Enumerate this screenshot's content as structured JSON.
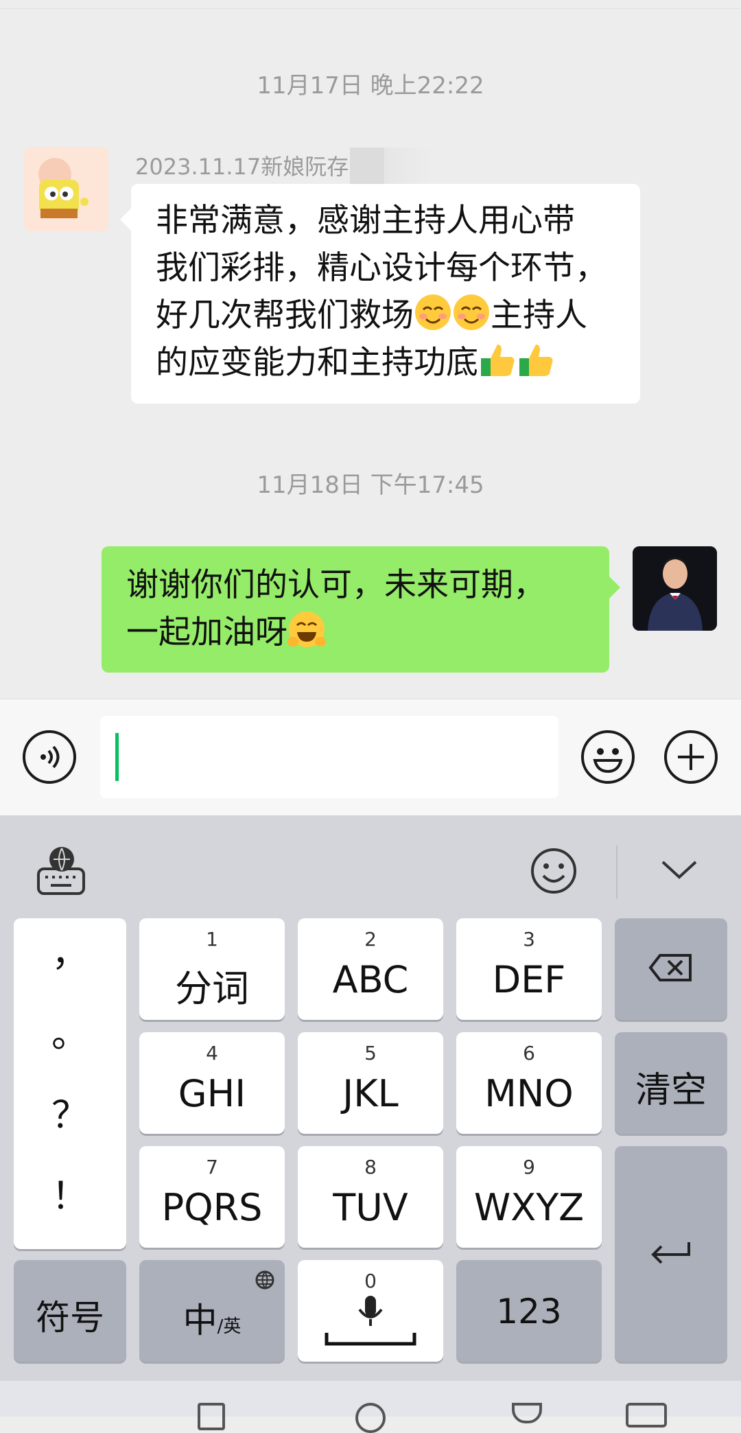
{
  "chat": {
    "timestamps": [
      "11月17日 晚上22:22",
      "11月18日 下午17:45"
    ],
    "incoming": {
      "sender": "2023.11.17新娘阮存",
      "lines": [
        "非常满意，感谢主持人用心带",
        "我们彩排，精心设计每个环节，",
        "好几次帮我们救场",
        "主持人",
        "的应变能力和主持功底"
      ]
    },
    "outgoing": {
      "lines": [
        "谢谢你们的认可，未来可期，",
        "一起加油呀"
      ]
    }
  },
  "input": {
    "value": ""
  },
  "keyboard": {
    "punct": [
      "，",
      "。",
      "？",
      "！"
    ],
    "keys": [
      {
        "num": "1",
        "label": "分词"
      },
      {
        "num": "2",
        "label": "ABC"
      },
      {
        "num": "3",
        "label": "DEF"
      },
      {
        "num": "4",
        "label": "GHI"
      },
      {
        "num": "5",
        "label": "JKL"
      },
      {
        "num": "6",
        "label": "MNO"
      },
      {
        "num": "7",
        "label": "PQRS"
      },
      {
        "num": "8",
        "label": "TUV"
      },
      {
        "num": "9",
        "label": "WXYZ"
      }
    ],
    "clear": "清空",
    "symbols": "符号",
    "lang_main": "中",
    "lang_sub": "/英",
    "space_num": "0",
    "numbers": "123"
  },
  "colors": {
    "outgoing_bubble": "#95ec69",
    "caret": "#07c160",
    "keyboard_bg": "#d4d5db"
  },
  "icons": [
    "voice-icon",
    "emoji-icon",
    "plus-icon",
    "keyboard-globe-icon",
    "smiley-icon",
    "chevron-down-icon",
    "backspace-icon",
    "enter-icon",
    "mic-icon",
    "globe-icon",
    "smiling-emoji",
    "thumbs-up-emoji",
    "grin-emoji"
  ]
}
